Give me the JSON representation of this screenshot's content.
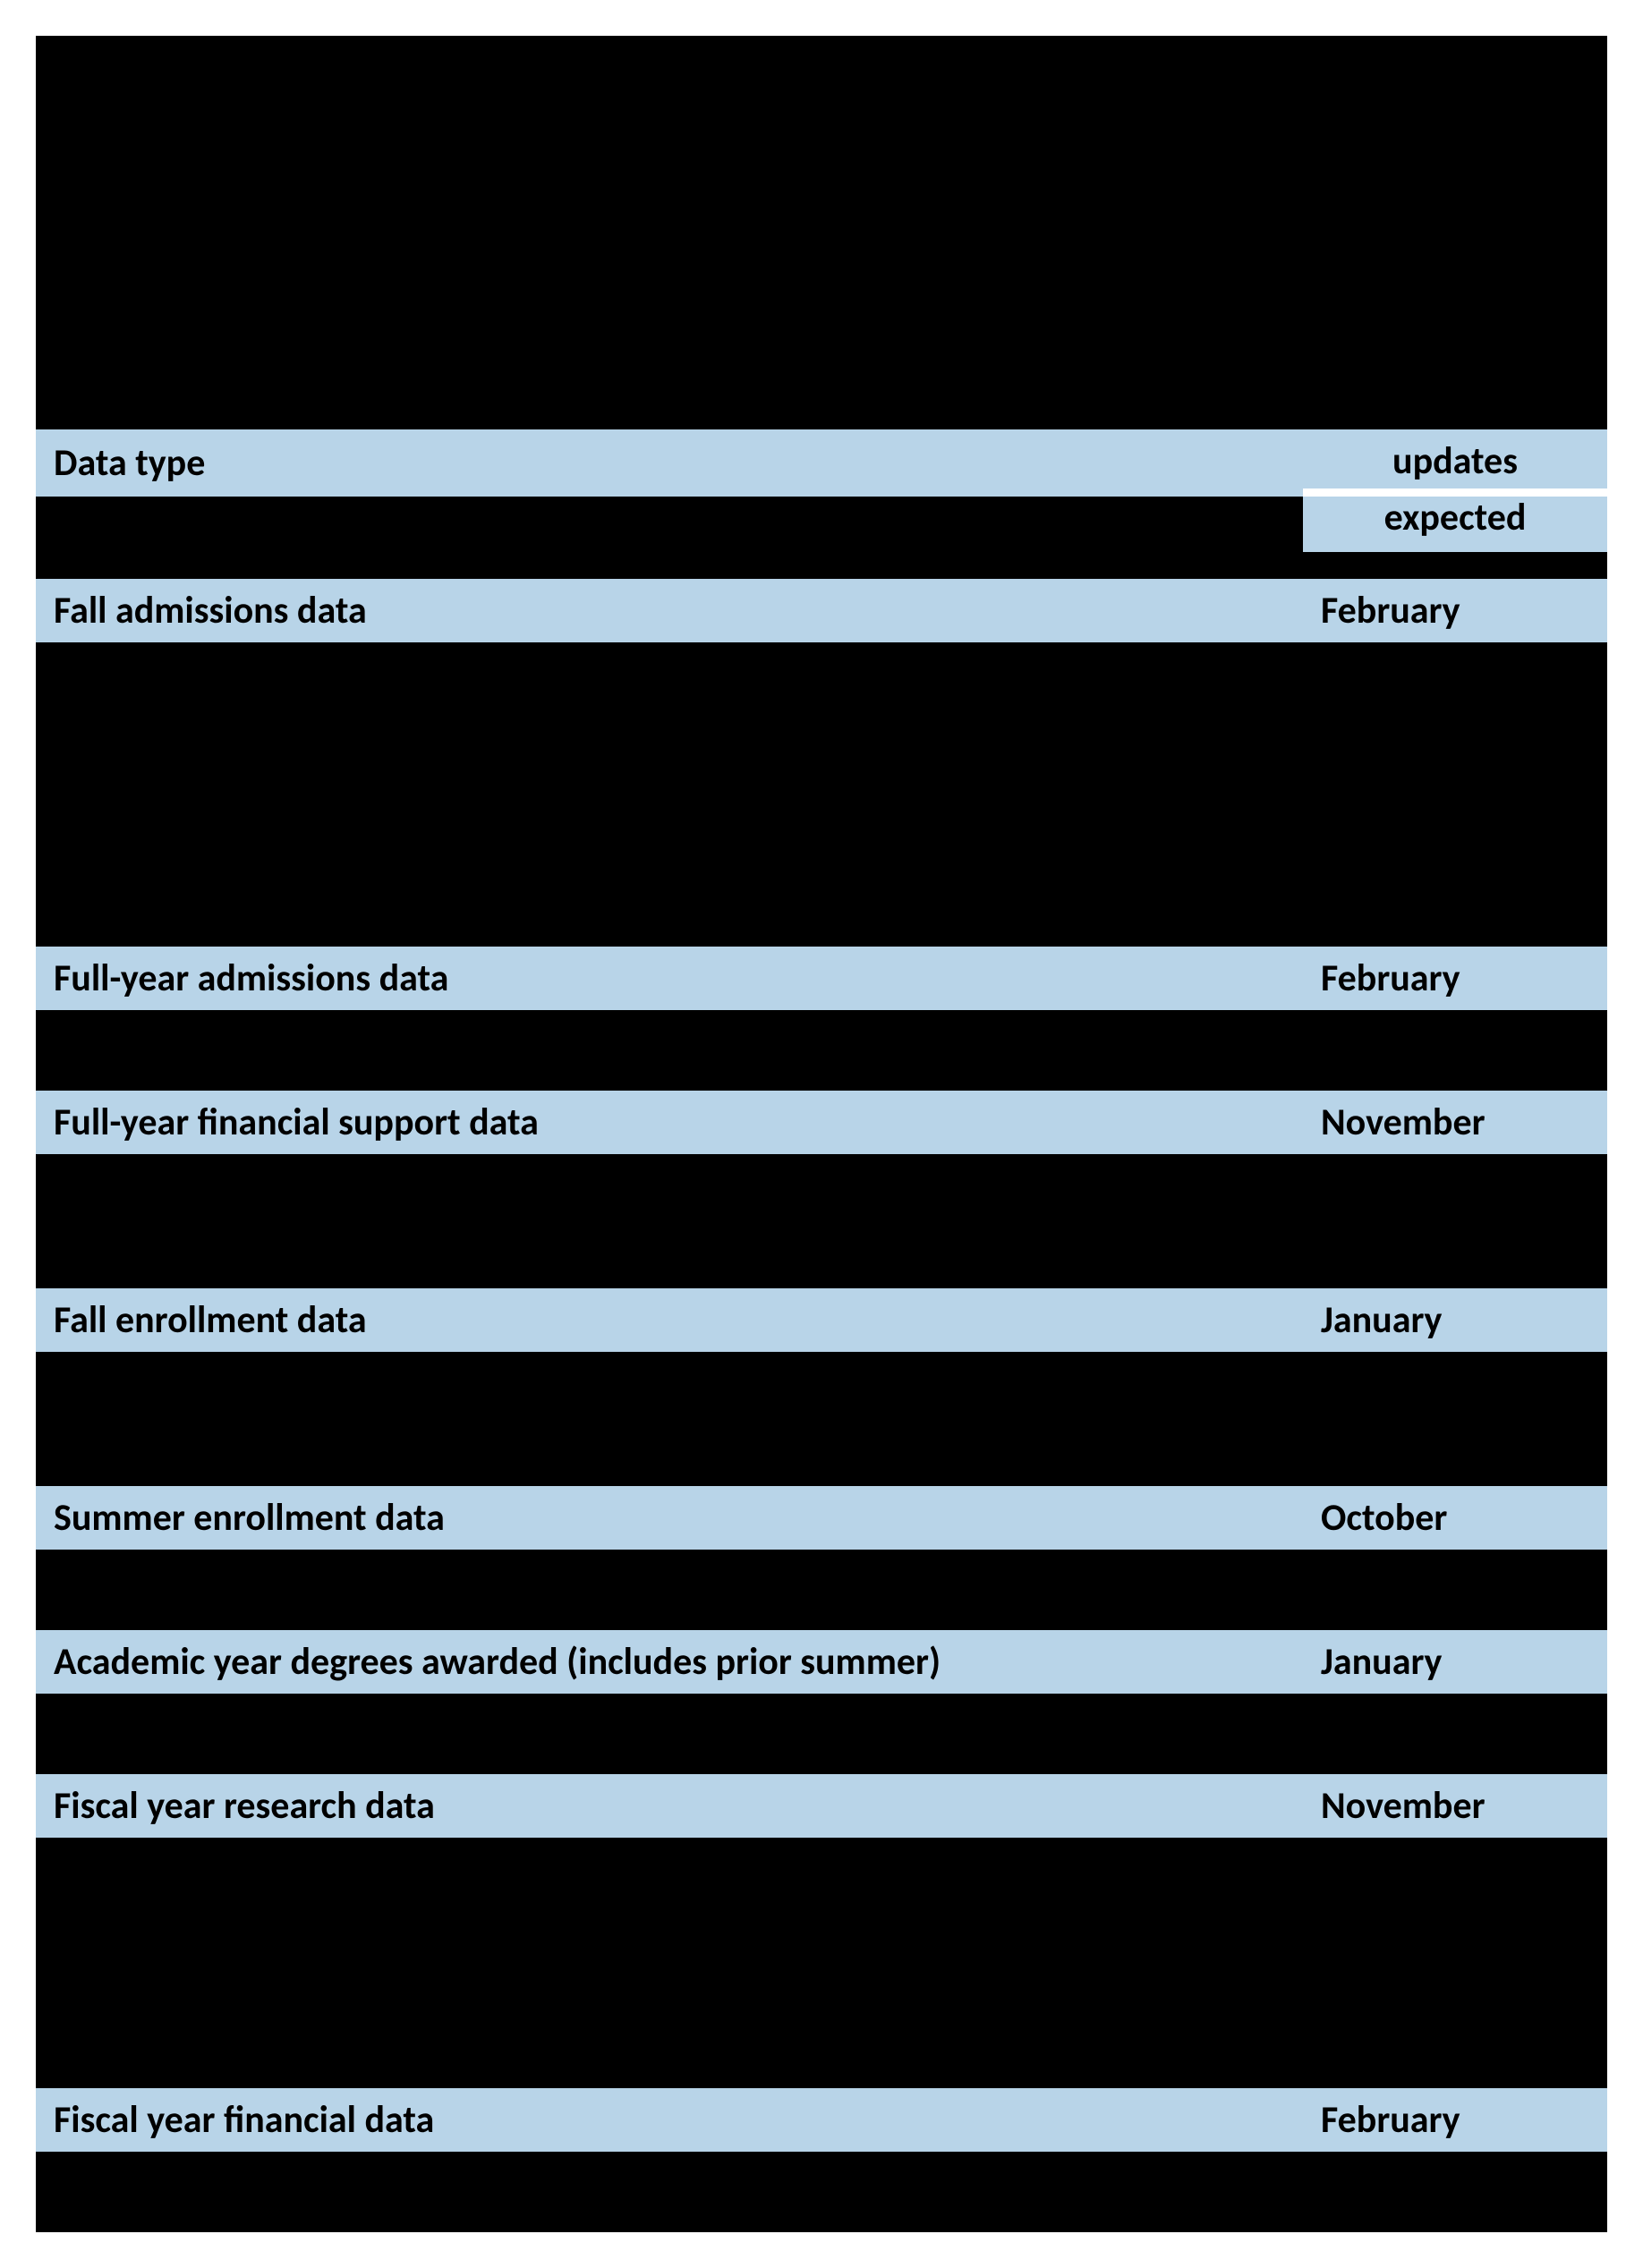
{
  "header": {
    "col1": "Data type",
    "col2_line1": "updates",
    "col2_line2": "expected"
  },
  "sections": [
    {
      "label": "Fall admissions data",
      "update": "February",
      "gap_after": 340
    },
    {
      "label": "Full-year admissions data",
      "update": "February",
      "gap_after": 90
    },
    {
      "label": "Full-year financial support data",
      "update": "November",
      "gap_after": 150
    },
    {
      "label": "Fall enrollment data",
      "update": "January",
      "gap_after": 150
    },
    {
      "label": "Summer enrollment data",
      "update": "October",
      "gap_after": 90
    },
    {
      "label": "Academic year degrees awarded (includes prior summer)",
      "update": "January",
      "gap_after": 90
    },
    {
      "label": "Fiscal year research data",
      "update": "November",
      "gap_after": 280
    },
    {
      "label": "Fiscal year financial data",
      "update": "February",
      "gap_after": 90
    }
  ]
}
